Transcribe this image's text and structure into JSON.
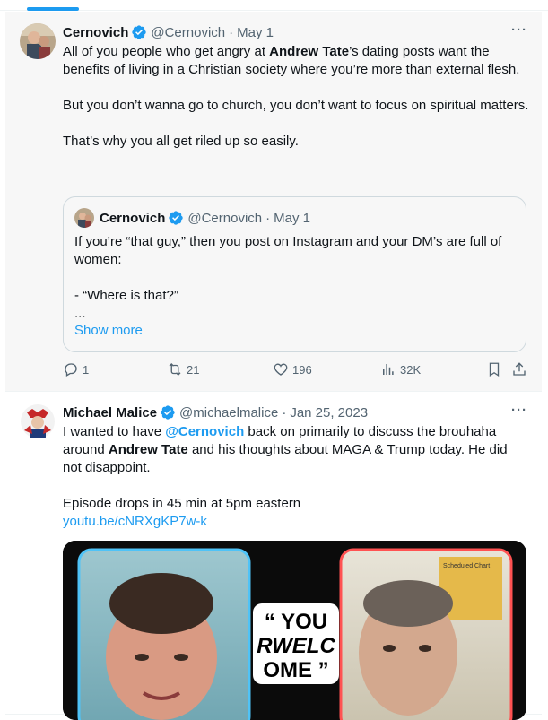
{
  "tweets": [
    {
      "name": "Cernovich",
      "handle": "@Cernovich",
      "date": "May 1",
      "more": "···",
      "body": {
        "l1_pre": "All of you people who get angry at ",
        "l1_bold": "Andrew Tate",
        "l1_post": "’s dating posts want the benefits of living in a Christian society where you’re more than external flesh.",
        "p2": "But you don’t wanna go to church, you don’t want to focus on spiritual matters.",
        "p3": "That’s why you all get riled up so easily."
      },
      "quote": {
        "name": "Cernovich",
        "handle": "@Cernovich",
        "date": "May 1",
        "line1": "If you’re “that guy,” then you post on Instagram and your DM’s are full of women:",
        "line2": "- “Where is that?”",
        "line3": "...",
        "show_more": "Show more"
      },
      "actions": {
        "replies": "1",
        "retweets": "21",
        "likes": "196",
        "views": "32K"
      }
    },
    {
      "name": "Michael Malice",
      "handle": "@michaelmalice",
      "date": "Jan 25, 2023",
      "more": "···",
      "body": {
        "pre": "I wanted to have ",
        "mention": "@Cernovich",
        "mid": " back on primarily to discuss the brouhaha around ",
        "bold": "Andrew Tate",
        "post": " and his thoughts about MAGA & Trump today. He did not disappoint.",
        "p2": "Episode drops in 45 min at 5pm eastern",
        "link": "youtu.be/cNRXgKP7w-k"
      },
      "media": {
        "caption_l1": "“ YOU",
        "caption_l2": "RWELC",
        "caption_l3": "OME ”",
        "chart_label": "Scheduled Chart"
      }
    }
  ],
  "colors": {
    "accent": "#1d9bf0",
    "muted": "#536471",
    "text": "#0f1419"
  }
}
